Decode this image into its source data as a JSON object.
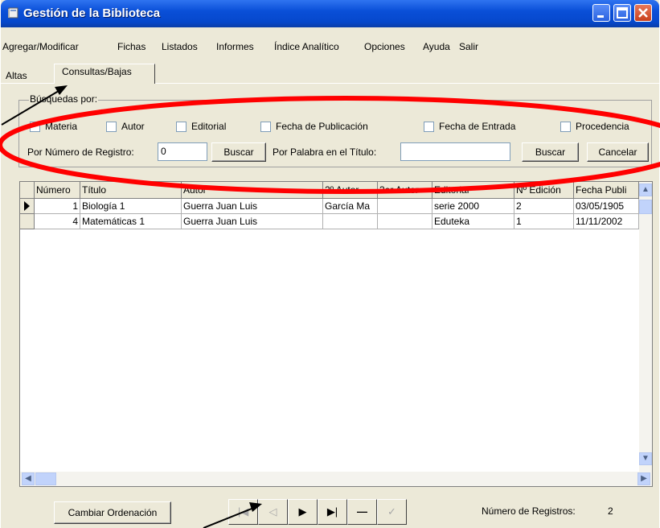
{
  "window": {
    "title": "Gestión de la Biblioteca"
  },
  "menu": [
    "Agregar/Modificar",
    "Fichas",
    "Listados",
    "Informes",
    "Índice Analítico",
    "Opciones",
    "Ayuda",
    "Salir"
  ],
  "tabs": {
    "altas": "Altas",
    "consultas": "Consultas/Bajas",
    "selected": "Consultas/Bajas"
  },
  "search": {
    "legend": "Búsquedas por:",
    "checkboxes": [
      "Materia",
      "Autor",
      "Editorial",
      "Fecha de Publicación",
      "Fecha de Entrada",
      "Procedencia"
    ],
    "registro_label": "Por Número de Registro:",
    "registro_value": "0",
    "buscar1": "Buscar",
    "palabra_label": "Por Palabra en el Título:",
    "palabra_value": "",
    "buscar2": "Buscar",
    "cancelar": "Cancelar"
  },
  "grid": {
    "columns": [
      "Número",
      "Título",
      "Autor",
      "2º Autor",
      "3er Autor",
      "Editorial",
      "Nº Edición",
      "Fecha Publi"
    ],
    "rows": [
      [
        "1",
        "Biología 1",
        "Guerra Juan Luis",
        "García Ma",
        "",
        "serie 2000",
        "2",
        "03/05/1905"
      ],
      [
        "4",
        "Matemáticas 1",
        "Guerra Juan Luis",
        "",
        "",
        "Eduteka",
        "1",
        "11/11/2002"
      ]
    ]
  },
  "footer": {
    "cambiar": "Cambiar Ordenación",
    "registros_label": "Número de Registros:",
    "registros_value": "2"
  },
  "colors": {
    "annotation": "#ff0000",
    "titlebar": "#0a4fd8"
  }
}
